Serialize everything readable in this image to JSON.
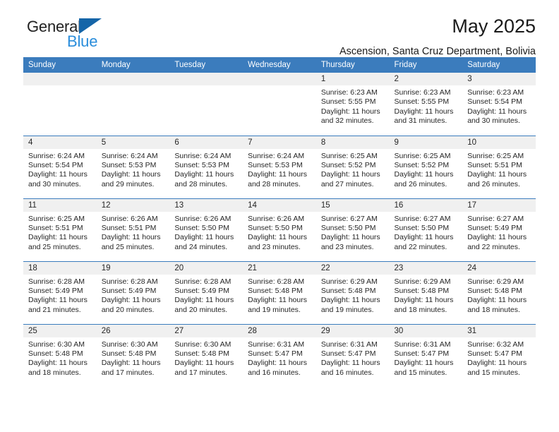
{
  "brand": {
    "name_part1": "General",
    "name_part2": "Blue",
    "triangle_color": "#1565a8",
    "blue_color": "#2a8ddb"
  },
  "header": {
    "title": "May 2025",
    "subtitle": "Ascension, Santa Cruz Department, Bolivia"
  },
  "colors": {
    "header_row": "#3b7cbd",
    "daynum_strip": "#f0f0f0",
    "text": "#262626"
  },
  "weekdays": [
    "Sunday",
    "Monday",
    "Tuesday",
    "Wednesday",
    "Thursday",
    "Friday",
    "Saturday"
  ],
  "labels": {
    "sunrise_prefix": "Sunrise:",
    "sunset_prefix": "Sunset:",
    "daylight_prefix": "Daylight:"
  },
  "weeks": [
    [
      {
        "day": "",
        "blank": true,
        "line1": "",
        "line2": "",
        "line3": "",
        "line4": ""
      },
      {
        "day": "",
        "blank": true,
        "line1": "",
        "line2": "",
        "line3": "",
        "line4": ""
      },
      {
        "day": "",
        "blank": true,
        "line1": "",
        "line2": "",
        "line3": "",
        "line4": ""
      },
      {
        "day": "",
        "blank": true,
        "line1": "",
        "line2": "",
        "line3": "",
        "line4": ""
      },
      {
        "day": "1",
        "blank": false,
        "line1": "Sunrise: 6:23 AM",
        "line2": "Sunset: 5:55 PM",
        "line3": "Daylight: 11 hours",
        "line4": "and 32 minutes."
      },
      {
        "day": "2",
        "blank": false,
        "line1": "Sunrise: 6:23 AM",
        "line2": "Sunset: 5:55 PM",
        "line3": "Daylight: 11 hours",
        "line4": "and 31 minutes."
      },
      {
        "day": "3",
        "blank": false,
        "line1": "Sunrise: 6:23 AM",
        "line2": "Sunset: 5:54 PM",
        "line3": "Daylight: 11 hours",
        "line4": "and 30 minutes."
      }
    ],
    [
      {
        "day": "4",
        "blank": false,
        "line1": "Sunrise: 6:24 AM",
        "line2": "Sunset: 5:54 PM",
        "line3": "Daylight: 11 hours",
        "line4": "and 30 minutes."
      },
      {
        "day": "5",
        "blank": false,
        "line1": "Sunrise: 6:24 AM",
        "line2": "Sunset: 5:53 PM",
        "line3": "Daylight: 11 hours",
        "line4": "and 29 minutes."
      },
      {
        "day": "6",
        "blank": false,
        "line1": "Sunrise: 6:24 AM",
        "line2": "Sunset: 5:53 PM",
        "line3": "Daylight: 11 hours",
        "line4": "and 28 minutes."
      },
      {
        "day": "7",
        "blank": false,
        "line1": "Sunrise: 6:24 AM",
        "line2": "Sunset: 5:53 PM",
        "line3": "Daylight: 11 hours",
        "line4": "and 28 minutes."
      },
      {
        "day": "8",
        "blank": false,
        "line1": "Sunrise: 6:25 AM",
        "line2": "Sunset: 5:52 PM",
        "line3": "Daylight: 11 hours",
        "line4": "and 27 minutes."
      },
      {
        "day": "9",
        "blank": false,
        "line1": "Sunrise: 6:25 AM",
        "line2": "Sunset: 5:52 PM",
        "line3": "Daylight: 11 hours",
        "line4": "and 26 minutes."
      },
      {
        "day": "10",
        "blank": false,
        "line1": "Sunrise: 6:25 AM",
        "line2": "Sunset: 5:51 PM",
        "line3": "Daylight: 11 hours",
        "line4": "and 26 minutes."
      }
    ],
    [
      {
        "day": "11",
        "blank": false,
        "line1": "Sunrise: 6:25 AM",
        "line2": "Sunset: 5:51 PM",
        "line3": "Daylight: 11 hours",
        "line4": "and 25 minutes."
      },
      {
        "day": "12",
        "blank": false,
        "line1": "Sunrise: 6:26 AM",
        "line2": "Sunset: 5:51 PM",
        "line3": "Daylight: 11 hours",
        "line4": "and 25 minutes."
      },
      {
        "day": "13",
        "blank": false,
        "line1": "Sunrise: 6:26 AM",
        "line2": "Sunset: 5:50 PM",
        "line3": "Daylight: 11 hours",
        "line4": "and 24 minutes."
      },
      {
        "day": "14",
        "blank": false,
        "line1": "Sunrise: 6:26 AM",
        "line2": "Sunset: 5:50 PM",
        "line3": "Daylight: 11 hours",
        "line4": "and 23 minutes."
      },
      {
        "day": "15",
        "blank": false,
        "line1": "Sunrise: 6:27 AM",
        "line2": "Sunset: 5:50 PM",
        "line3": "Daylight: 11 hours",
        "line4": "and 23 minutes."
      },
      {
        "day": "16",
        "blank": false,
        "line1": "Sunrise: 6:27 AM",
        "line2": "Sunset: 5:50 PM",
        "line3": "Daylight: 11 hours",
        "line4": "and 22 minutes."
      },
      {
        "day": "17",
        "blank": false,
        "line1": "Sunrise: 6:27 AM",
        "line2": "Sunset: 5:49 PM",
        "line3": "Daylight: 11 hours",
        "line4": "and 22 minutes."
      }
    ],
    [
      {
        "day": "18",
        "blank": false,
        "line1": "Sunrise: 6:28 AM",
        "line2": "Sunset: 5:49 PM",
        "line3": "Daylight: 11 hours",
        "line4": "and 21 minutes."
      },
      {
        "day": "19",
        "blank": false,
        "line1": "Sunrise: 6:28 AM",
        "line2": "Sunset: 5:49 PM",
        "line3": "Daylight: 11 hours",
        "line4": "and 20 minutes."
      },
      {
        "day": "20",
        "blank": false,
        "line1": "Sunrise: 6:28 AM",
        "line2": "Sunset: 5:49 PM",
        "line3": "Daylight: 11 hours",
        "line4": "and 20 minutes."
      },
      {
        "day": "21",
        "blank": false,
        "line1": "Sunrise: 6:28 AM",
        "line2": "Sunset: 5:48 PM",
        "line3": "Daylight: 11 hours",
        "line4": "and 19 minutes."
      },
      {
        "day": "22",
        "blank": false,
        "line1": "Sunrise: 6:29 AM",
        "line2": "Sunset: 5:48 PM",
        "line3": "Daylight: 11 hours",
        "line4": "and 19 minutes."
      },
      {
        "day": "23",
        "blank": false,
        "line1": "Sunrise: 6:29 AM",
        "line2": "Sunset: 5:48 PM",
        "line3": "Daylight: 11 hours",
        "line4": "and 18 minutes."
      },
      {
        "day": "24",
        "blank": false,
        "line1": "Sunrise: 6:29 AM",
        "line2": "Sunset: 5:48 PM",
        "line3": "Daylight: 11 hours",
        "line4": "and 18 minutes."
      }
    ],
    [
      {
        "day": "25",
        "blank": false,
        "line1": "Sunrise: 6:30 AM",
        "line2": "Sunset: 5:48 PM",
        "line3": "Daylight: 11 hours",
        "line4": "and 18 minutes."
      },
      {
        "day": "26",
        "blank": false,
        "line1": "Sunrise: 6:30 AM",
        "line2": "Sunset: 5:48 PM",
        "line3": "Daylight: 11 hours",
        "line4": "and 17 minutes."
      },
      {
        "day": "27",
        "blank": false,
        "line1": "Sunrise: 6:30 AM",
        "line2": "Sunset: 5:48 PM",
        "line3": "Daylight: 11 hours",
        "line4": "and 17 minutes."
      },
      {
        "day": "28",
        "blank": false,
        "line1": "Sunrise: 6:31 AM",
        "line2": "Sunset: 5:47 PM",
        "line3": "Daylight: 11 hours",
        "line4": "and 16 minutes."
      },
      {
        "day": "29",
        "blank": false,
        "line1": "Sunrise: 6:31 AM",
        "line2": "Sunset: 5:47 PM",
        "line3": "Daylight: 11 hours",
        "line4": "and 16 minutes."
      },
      {
        "day": "30",
        "blank": false,
        "line1": "Sunrise: 6:31 AM",
        "line2": "Sunset: 5:47 PM",
        "line3": "Daylight: 11 hours",
        "line4": "and 15 minutes."
      },
      {
        "day": "31",
        "blank": false,
        "line1": "Sunrise: 6:32 AM",
        "line2": "Sunset: 5:47 PM",
        "line3": "Daylight: 11 hours",
        "line4": "and 15 minutes."
      }
    ]
  ]
}
